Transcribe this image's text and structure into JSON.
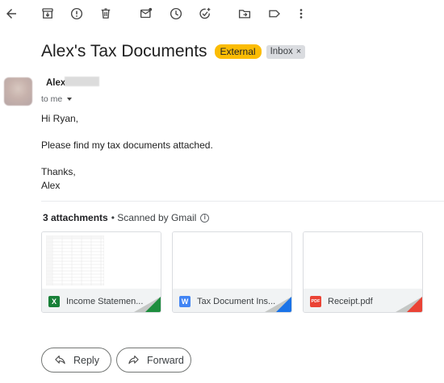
{
  "toolbar": {
    "icons": [
      "back-arrow-icon",
      "archive-icon",
      "report-spam-icon",
      "delete-icon",
      "mark-unread-icon",
      "snooze-icon",
      "add-to-tasks-icon",
      "move-to-icon",
      "label-icon",
      "more-options-icon"
    ]
  },
  "email": {
    "subject": "Alex's Tax Documents",
    "badge_external": "External",
    "badge_inbox": "Inbox",
    "badge_inbox_close": "×",
    "sender_name": "Alex",
    "to_label": "to me",
    "body": {
      "greeting": "Hi Ryan,",
      "message": "Please find my tax documents attached.",
      "signoff": "Thanks,",
      "signature": "Alex"
    }
  },
  "attachments": {
    "count_label": "3 attachments",
    "scan_label": "• Scanned by Gmail",
    "info_glyph": "i",
    "files": [
      {
        "name": "Income Statemen...",
        "type_letter": "X",
        "icon_color": "#188038",
        "corner_color": "#1e8e3e"
      },
      {
        "name": "Tax Document Ins...",
        "type_letter": "W",
        "icon_color": "#4285f4",
        "corner_color": "#1a73e8"
      },
      {
        "name": "Receipt.pdf",
        "type_letter": "PDF",
        "icon_color": "#ea4335",
        "corner_color": "#ea4335"
      }
    ]
  },
  "actions": {
    "reply_label": "Reply",
    "forward_label": "Forward"
  }
}
